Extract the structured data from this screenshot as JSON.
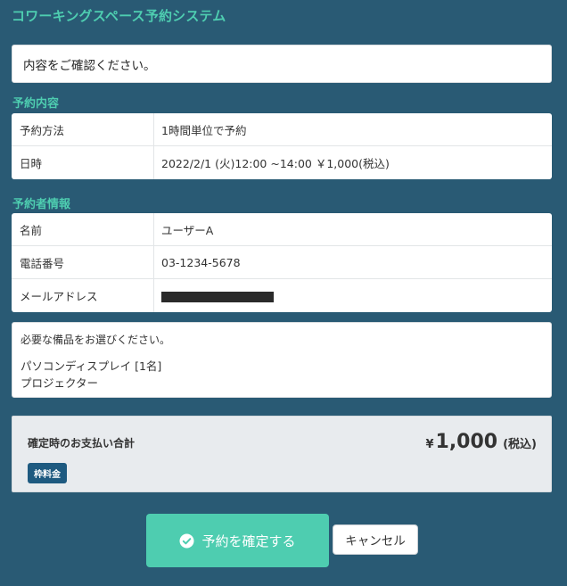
{
  "app": {
    "title": "コワーキングスペース予約システム"
  },
  "notice": {
    "text": "内容をご確認ください。"
  },
  "reservation": {
    "heading": "予約内容",
    "rows": [
      {
        "label": "予約方法",
        "value": "1時間単位で予約"
      },
      {
        "label": "日時",
        "value": "2022/2/1 (火)12:00 ~14:00 ￥1,000(税込)"
      }
    ]
  },
  "reserver": {
    "heading": "予約者情報",
    "rows": [
      {
        "label": "名前",
        "value": "ユーザーA"
      },
      {
        "label": "電話番号",
        "value": "03-1234-5678"
      },
      {
        "label": "メールアドレス",
        "value": ""
      }
    ]
  },
  "equipment": {
    "prompt": "必要な備品をお選びください。",
    "items": [
      "パソコンディスプレイ [1名]",
      "プロジェクター"
    ]
  },
  "total": {
    "label": "確定時のお支払い合計",
    "currency_symbol": "¥",
    "amount": "1,000",
    "tax_note": "(税込)",
    "badge": "枠料金"
  },
  "actions": {
    "confirm_label": "予約を確定する",
    "confirm_icon": "check-circle-icon",
    "cancel_label": "キャンセル"
  },
  "colors": {
    "background": "#295a74",
    "accent": "#4ecdb0",
    "badge": "#1e5a80",
    "total_bg": "#e8ebee"
  }
}
